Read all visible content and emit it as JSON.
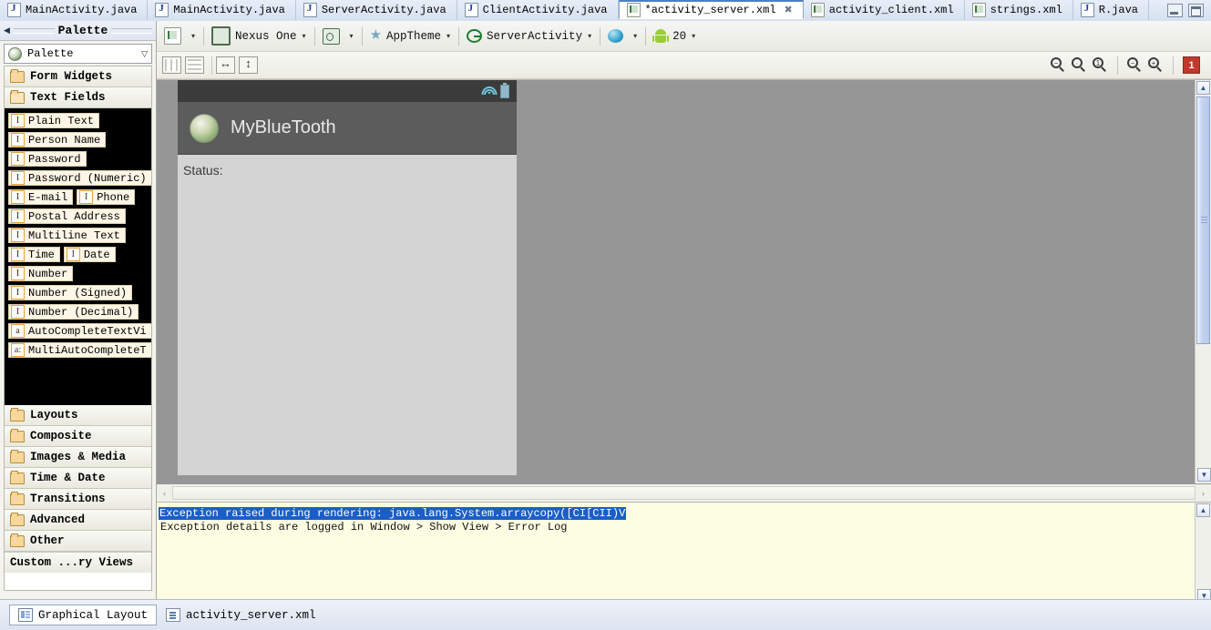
{
  "window": {
    "minimize_label": "Minimize",
    "maximize_label": "Maximize"
  },
  "tabs": [
    {
      "label": "MainActivity.java",
      "icon": "java-file-icon",
      "active": false
    },
    {
      "label": "MainActivity.java",
      "icon": "java-file-icon",
      "active": false
    },
    {
      "label": "ServerActivity.java",
      "icon": "java-file-icon",
      "active": false
    },
    {
      "label": "ClientActivity.java",
      "icon": "java-file-icon",
      "active": false
    },
    {
      "label": "*activity_server.xml",
      "icon": "xml-file-icon",
      "active": true,
      "close": "✖"
    },
    {
      "label": "activity_client.xml",
      "icon": "xml-file-icon",
      "active": false
    },
    {
      "label": "strings.xml",
      "icon": "xml-file-icon",
      "active": false
    },
    {
      "label": "R.java",
      "icon": "java-file-icon",
      "active": false
    }
  ],
  "palette": {
    "title": "Palette",
    "back_arrow": "◀",
    "selector_label": "Palette",
    "selector_icon": "globe-icon",
    "chevron": "▽",
    "groups_top": [
      {
        "label": "Form Widgets",
        "icon": "folder-icon",
        "open": false
      },
      {
        "label": "Text Fields",
        "icon": "folder-open-icon",
        "open": true
      }
    ],
    "text_field_rows": [
      [
        {
          "label": "Plain Text",
          "icon": "I"
        }
      ],
      [
        {
          "label": "Person Name",
          "icon": "I"
        }
      ],
      [
        {
          "label": "Password",
          "icon": "I"
        }
      ],
      [
        {
          "label": "Password (Numeric)",
          "icon": "I"
        }
      ],
      [
        {
          "label": "E-mail",
          "icon": "I"
        },
        {
          "label": "Phone",
          "icon": "I"
        }
      ],
      [
        {
          "label": "Postal Address",
          "icon": "I"
        }
      ],
      [
        {
          "label": "Multiline Text",
          "icon": "I"
        }
      ],
      [
        {
          "label": "Time",
          "icon": "I"
        },
        {
          "label": "Date",
          "icon": "I"
        }
      ],
      [
        {
          "label": "Number",
          "icon": "I"
        }
      ],
      [
        {
          "label": "Number (Signed)",
          "icon": "I"
        }
      ],
      [
        {
          "label": "Number (Decimal)",
          "icon": "I"
        }
      ],
      [
        {
          "label": "AutoCompleteTextVi",
          "icon": "a"
        }
      ],
      [
        {
          "label": "MultiAutoCompleteT",
          "icon": "a:"
        }
      ]
    ],
    "groups_bottom": [
      {
        "label": "Layouts",
        "icon": "folder-icon"
      },
      {
        "label": "Composite",
        "icon": "folder-icon"
      },
      {
        "label": "Images & Media",
        "icon": "folder-icon"
      },
      {
        "label": "Time & Date",
        "icon": "folder-icon"
      },
      {
        "label": "Transitions",
        "icon": "folder-icon"
      },
      {
        "label": "Advanced",
        "icon": "folder-icon"
      },
      {
        "label": "Other",
        "icon": "folder-icon"
      }
    ],
    "custom_views": "Custom ...ry Views"
  },
  "toolbar": {
    "layout_file": {
      "label": "",
      "icon": "layout-file-icon",
      "caret": "▾"
    },
    "device": {
      "label": "Nexus One",
      "icon": "phone-icon",
      "caret": "▾"
    },
    "config": {
      "label": "",
      "icon": "config-icon",
      "caret": "▾"
    },
    "theme": {
      "label": "AppTheme",
      "icon": "star-icon",
      "caret": "▾"
    },
    "activity": {
      "label": "ServerActivity",
      "icon": "activity-icon",
      "caret": "▾"
    },
    "locale": {
      "label": "",
      "icon": "locale-globe-icon",
      "caret": "▾"
    },
    "api_level": {
      "label": "20",
      "icon": "android-robot-icon",
      "caret": "▾"
    }
  },
  "toolbar2": {
    "buttons": [
      {
        "name": "show-columns",
        "title": "Columns"
      },
      {
        "name": "show-rows",
        "title": "Rows"
      },
      {
        "name": "fill-horizontal",
        "title": "Fill horizontal"
      },
      {
        "name": "fill-vertical",
        "title": "Fill vertical"
      }
    ],
    "zoom_buttons": [
      {
        "name": "zoom-out-button",
        "glyph": "−"
      },
      {
        "name": "zoom-fit-button",
        "glyph": "∙"
      },
      {
        "name": "zoom-100-button",
        "glyph": "1"
      },
      {
        "name": "zoom-minus-button",
        "glyph": "−"
      },
      {
        "name": "zoom-plus-button",
        "glyph": "+"
      }
    ],
    "error_badge": "1"
  },
  "preview": {
    "app_title": "MyBlueTooth",
    "status_label": "Status:",
    "wifi_icon": "wifi-icon",
    "battery_icon": "battery-icon",
    "app_icon": "android-app-icon"
  },
  "scrollbars": {
    "up_arrow": "▲",
    "down_arrow": "▼",
    "left_arrow": "‹",
    "right_arrow": "›"
  },
  "error_panel": {
    "line1": "Exception raised during rendering: java.lang.System.arraycopy([CI[CII)V",
    "line2": "Exception details are logged in Window > Show View > Error Log",
    "highlight_color": "#1b5ec7",
    "background_color": "#fdfde4"
  },
  "bottom_tabs": [
    {
      "label": "Graphical Layout",
      "icon": "graphical-layout-icon",
      "active": true
    },
    {
      "label": "activity_server.xml",
      "icon": "xml-doc-icon",
      "active": false
    }
  ]
}
